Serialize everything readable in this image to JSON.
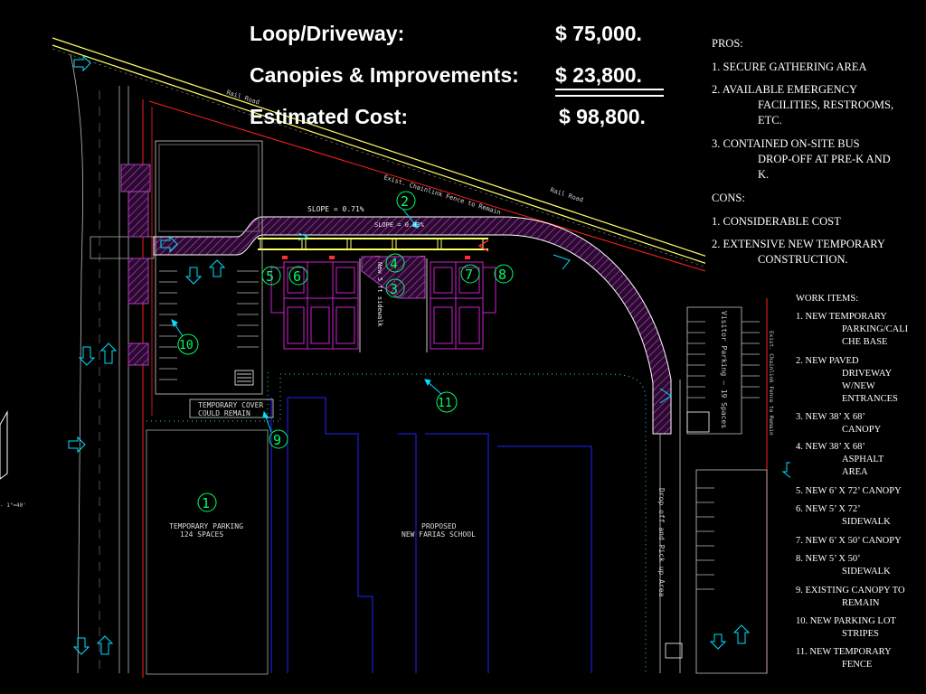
{
  "costs": {
    "loop_label": "Loop/Driveway:",
    "loop_amount": "$ 75,000.",
    "canopies_label": "Canopies & Improvements:",
    "canopies_amount": "$ 23,800.",
    "estimated_label": "Estimated Cost:",
    "estimated_amount": "$ 98,800."
  },
  "pros_cons": {
    "pros_heading": "PROS:",
    "pros": [
      [
        "1. SECURE GATHERING AREA"
      ],
      [
        "2. AVAILABLE EMERGENCY",
        "FACILITIES, RESTROOMS,",
        "ETC."
      ],
      [
        "3. CONTAINED ON-SITE BUS",
        "DROP-OFF AT PRE-K AND",
        "K."
      ]
    ],
    "cons_heading": "CONS:",
    "cons": [
      [
        "1. CONSIDERABLE COST"
      ],
      [
        "2. EXTENSIVE NEW TEMPORARY",
        "CONSTRUCTION."
      ]
    ]
  },
  "work_items": {
    "heading": "WORK ITEMS:",
    "items": [
      [
        "1. NEW TEMPORARY",
        "PARKING/CALI",
        "CHE BASE"
      ],
      [
        "2. NEW PAVED",
        "DRIVEWAY",
        "W/NEW",
        "ENTRANCES"
      ],
      [
        "3. NEW 38’ X 68’",
        "CANOPY"
      ],
      [
        "4. NEW 38’ X 68’",
        "ASPHALT",
        "AREA"
      ],
      [
        "5. NEW 6’ X 72’ CANOPY"
      ],
      [
        "6. NEW 5’ X 72’",
        "SIDEWALK"
      ],
      [
        "7. NEW 6’ X 50’ CANOPY"
      ],
      [
        "8. NEW 5’ X 50’",
        "SIDEWALK"
      ],
      [
        "9. EXISTING CANOPY TO",
        "REMAIN"
      ],
      [
        "10. NEW PARKING LOT",
        "STRIPES"
      ],
      [
        "11. NEW TEMPORARY",
        "FENCE"
      ]
    ]
  },
  "plan": {
    "rail_road_1": "Rail Road",
    "rail_road_2": "Rail Road",
    "fence_note": "Exist. Chainlink Fence to Remain",
    "fence_note_right": "Exist. Chainlink Fence to Remain",
    "slope_1": "SLOPE = 0.71%",
    "slope_2": "SLOPE = 0.03%",
    "sidewalk_note": "New 5 ft sidewalk",
    "temp_cover_1": "TEMPORARY COVER",
    "temp_cover_2": "COULD REMAIN",
    "temp_parking_1": "TEMPORARY PARKING",
    "temp_parking_2": "124 SPACES",
    "school_1": "PROPOSED",
    "school_2": "NEW FARIAS SCHOOL",
    "visitor_parking": "Visitor Parking — 19 Spaces",
    "dropoff": "Drop off and Pick up Area",
    "scale": "- 1\"=40'",
    "callouts": [
      "1",
      "2",
      "3",
      "4",
      "5",
      "6",
      "7",
      "8",
      "9",
      "10",
      "11"
    ]
  },
  "colors": {
    "driveway_stroke": "#ffffff",
    "hatch": "#b040c0",
    "building": "#d020d0",
    "road_line": "#ffff66",
    "callout": "#00ff66",
    "arrow": "#00e0ff",
    "property_line": "#ff2020",
    "school_outline": "#2222ff",
    "fence": "#22ddaa"
  }
}
